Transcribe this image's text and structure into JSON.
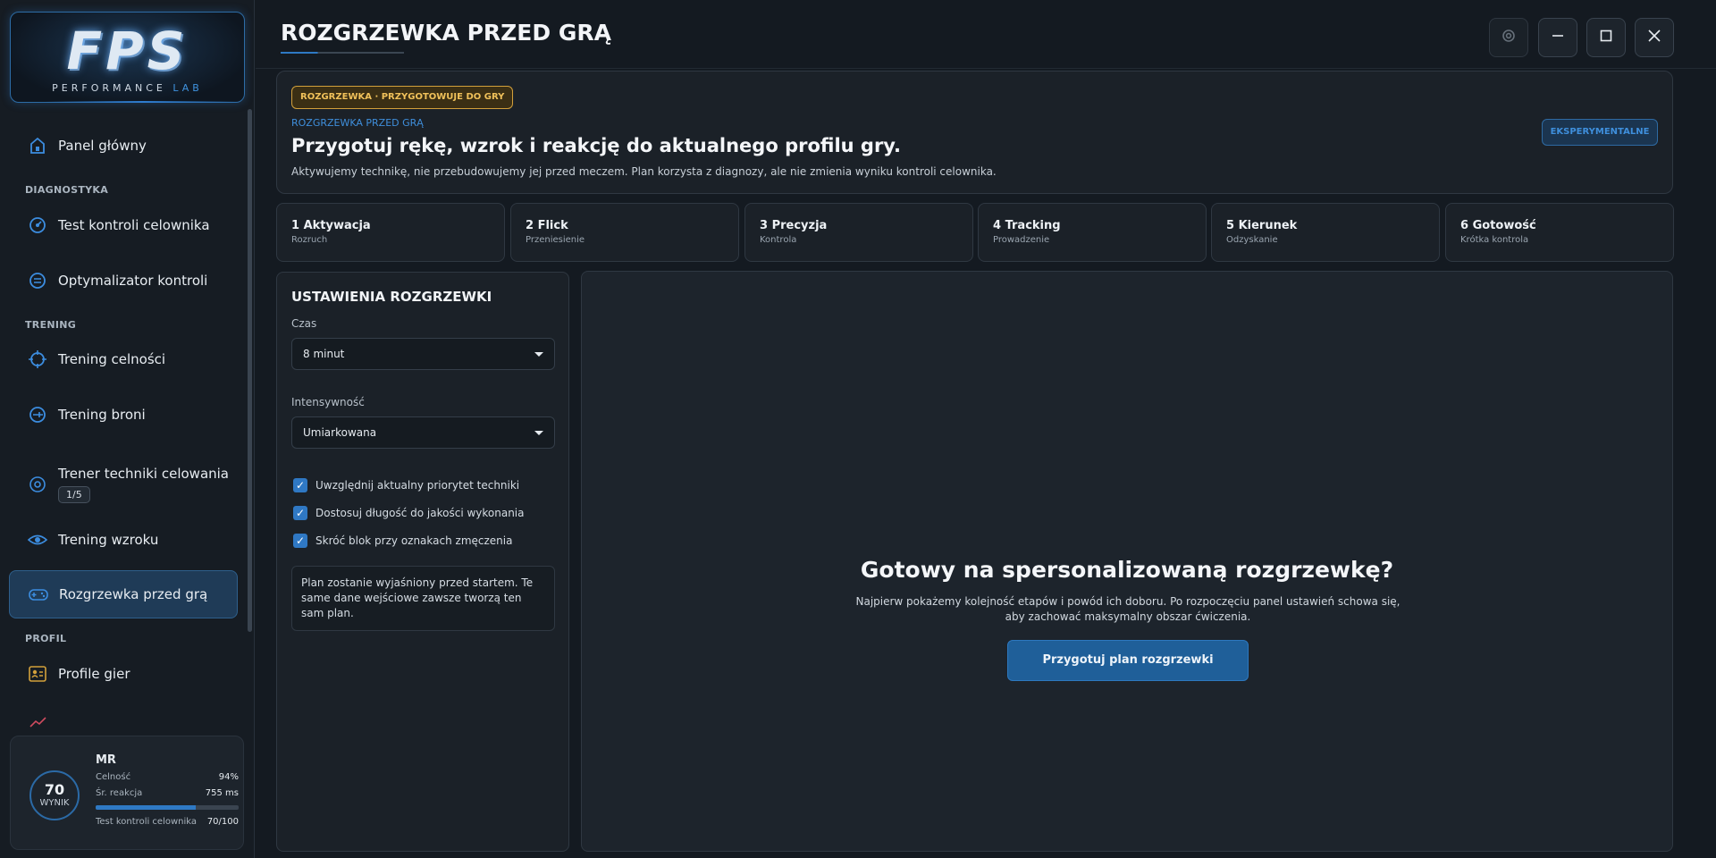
{
  "logo": {
    "mark": "FPS",
    "sub_main": "PERFORMANCE",
    "sub_accent": "LAB"
  },
  "nav": {
    "home": "Panel główny",
    "sec_diag": "DIAGNOSTYKA",
    "crosshair_test": "Test kontroli celownika",
    "optimizer": "Optymalizator kontroli",
    "sec_train": "TRENING",
    "accuracy": "Trening celności",
    "weapon": "Trening broni",
    "coach": "Trener techniki celowania",
    "coach_badge": "1/5",
    "vision": "Trening wzroku",
    "warmup": "Rozgrzewka przed grą",
    "sec_profile": "PROFIL",
    "game_profiles": "Profile gier"
  },
  "profile_card": {
    "score": "70",
    "score_label": "WYNIK",
    "name": "MR",
    "accuracy_label": "Celność",
    "accuracy_value": "94%",
    "reaction_label": "Śr. reakcja",
    "reaction_value": "755 ms",
    "progress_fraction": 0.7,
    "test_label": "Test kontroli celownika",
    "test_value": "70/100"
  },
  "header": {
    "title": "ROZGRZEWKA PRZED GRĄ"
  },
  "hero": {
    "badge": "ROZGRZEWKA · PRZYGOTOWUJE DO GRY",
    "kicker": "ROZGRZEWKA PRZED GRĄ",
    "title": "Przygotuj rękę, wzrok i reakcję do aktualnego profilu gry.",
    "desc": "Aktywujemy technikę, nie przebudowujemy jej przed meczem. Plan korzysta z diagnozy, ale nie zmienia wyniku kontroli celownika.",
    "exp_badge": "EKSPERYMENTALNE"
  },
  "steps": [
    {
      "title": "1  Aktywacja",
      "sub": "Rozruch"
    },
    {
      "title": "2  Flick",
      "sub": "Przeniesienie"
    },
    {
      "title": "3  Precyzja",
      "sub": "Kontrola"
    },
    {
      "title": "4  Tracking",
      "sub": "Prowadzenie"
    },
    {
      "title": "5  Kierunek",
      "sub": "Odzyskanie"
    },
    {
      "title": "6  Gotowość",
      "sub": "Krótka kontrola"
    }
  ],
  "settings": {
    "title": "USTAWIENIA ROZGRZEWKI",
    "time_label": "Czas",
    "time_value": "8 minut",
    "intensity_label": "Intensywność",
    "intensity_value": "Umiarkowana",
    "checks": [
      "Uwzględnij aktualny priorytet techniki",
      "Dostosuj długość do jakości wykonania",
      "Skróć blok przy oznakach zmęczenia"
    ],
    "note": "Plan zostanie wyjaśniony przed startem. Te same dane wejściowe zawsze tworzą ten sam plan."
  },
  "main": {
    "title": "Gotowy na spersonalizowaną rozgrzewkę?",
    "desc": "Najpierw pokażemy kolejność etapów i powód ich doboru. Po rozpoczęciu panel ustawień schowa się, aby zachować maksymalny obszar ćwiczenia.",
    "button": "Przygotuj plan rozgrzewki"
  },
  "colors": {
    "accent": "#2e79c4",
    "warning": "#d2a03b",
    "background": "#141a21"
  }
}
